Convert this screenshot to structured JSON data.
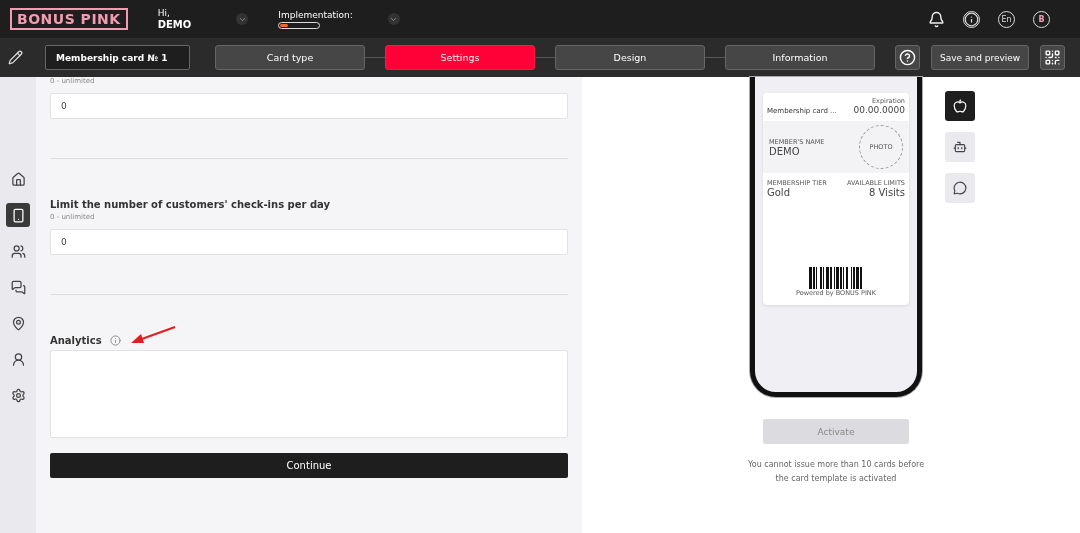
{
  "header": {
    "logo": "BONUS PINK",
    "greeting": "Hi,",
    "user": "DEMO",
    "implementation": {
      "label": "Implementation:",
      "level": 0.2
    },
    "language": "En",
    "avatar": "B"
  },
  "toolbar": {
    "card_name": "Membership card № 1",
    "steps": [
      {
        "label": "Card type",
        "selected": false
      },
      {
        "label": "Settings",
        "selected": true
      },
      {
        "label": "Design",
        "selected": false
      },
      {
        "label": "Information",
        "selected": false
      }
    ],
    "save_button": "Save and preview"
  },
  "sidebar": {
    "items": [
      {
        "kind": "home",
        "selected": false
      },
      {
        "kind": "card",
        "selected": true
      },
      {
        "kind": "clients",
        "selected": false
      },
      {
        "kind": "chat",
        "selected": false
      },
      {
        "kind": "location",
        "selected": false
      },
      {
        "kind": "user",
        "selected": false
      },
      {
        "kind": "settings",
        "selected": false
      }
    ]
  },
  "form": {
    "sections": [
      {
        "hint": "0 - unlimited",
        "value": "0"
      },
      {
        "label": "Limit the number of customers' check-ins per day",
        "hint": "0 - unlimited",
        "value": "0"
      }
    ],
    "analytics_label": "Analytics",
    "continue_button": "Continue"
  },
  "preview": {
    "card": {
      "title": "Membership card ...",
      "expiration_label": "Expiration",
      "expiration": "00.00.0000",
      "name_label": "MEMBER'S NAME",
      "name": "DEMO",
      "photo": "PHOTO",
      "tier_label": "MEMBERSHIP TIER",
      "tier": "Gold",
      "limits_label": "AVAILABLE LIMITS",
      "limits": "8 Visits",
      "powered": "Powered by BONUS PINK"
    },
    "platforms": [
      {
        "kind": "apple",
        "selected": true
      },
      {
        "kind": "android",
        "selected": false
      },
      {
        "kind": "chat",
        "selected": false
      }
    ],
    "activate_button": {
      "label": "Activate",
      "disabled": true
    },
    "note": "You cannot issue more than 10 cards before the card template is activated"
  }
}
